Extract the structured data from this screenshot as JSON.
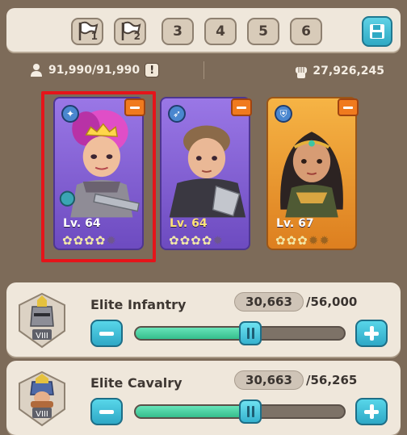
{
  "presets": [
    {
      "type": "flag",
      "label": "1"
    },
    {
      "type": "flag",
      "label": "2"
    },
    {
      "type": "number",
      "label": "3"
    },
    {
      "type": "number",
      "label": "4"
    },
    {
      "type": "number",
      "label": "5"
    },
    {
      "type": "number",
      "label": "6"
    }
  ],
  "save_icon": "save-icon",
  "stats": {
    "capacity": "91,990/91,990",
    "power": "27,926,245"
  },
  "heroes": [
    {
      "level": "Lv. 64",
      "stars_filled": 4,
      "stars_total": 5,
      "class": "infantry",
      "rarity_color": "#8a66d8",
      "selected": true
    },
    {
      "level": "Lv. 64",
      "stars_filled": 4,
      "stars_total": 5,
      "class": "archer",
      "rarity_color": "#8a66d8",
      "selected": false
    },
    {
      "level": "Lv. 67",
      "stars_filled": 3,
      "stars_total": 5,
      "class": "shield",
      "rarity_color": "#ee9a32",
      "selected": false
    }
  ],
  "troops": [
    {
      "name": "Elite Infantry",
      "count": "30,663",
      "max": "/56,000",
      "tier": "VIII",
      "fill": 0.55
    },
    {
      "name": "Elite Cavalry",
      "count": "30,663",
      "max": "/56,265",
      "tier": "VIII",
      "fill": 0.55
    }
  ],
  "colors": {
    "accent_button": "#2ea8c6",
    "slider_fill": "#35be8c",
    "remove_button": "#f07a1e",
    "selection_frame": "#e5141a"
  }
}
